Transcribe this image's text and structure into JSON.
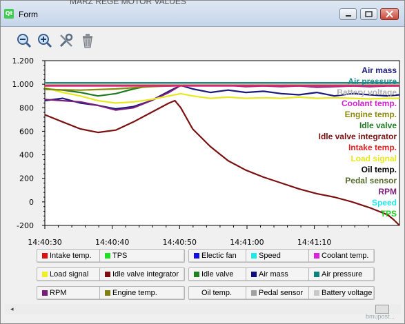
{
  "window": {
    "title": "Form",
    "logo": "Qt",
    "top_clip": "MARZ REGE MOTOR VALUES"
  },
  "controls": {
    "minimize": "minimize-icon",
    "maximize": "maximize-icon",
    "close": "close-icon"
  },
  "toolbar": {
    "tools": [
      "zoom-out-icon",
      "zoom-in-icon",
      "settings-tools-icon",
      "trash-icon"
    ]
  },
  "chart_data": {
    "type": "line",
    "y_ticks": [
      "1.200",
      "1.000",
      "800",
      "600",
      "400",
      "200",
      "0",
      "-200"
    ],
    "x_ticks": [
      "14:40:30",
      "14:40:40",
      "14:40:50",
      "14:41:00",
      "14:41:10"
    ],
    "ylim": [
      -200,
      1200
    ],
    "grid": false,
    "legend_placement": "right",
    "overlay_labels": [
      {
        "name": "Air mass",
        "color": "#1a1a7a"
      },
      {
        "name": "Air pressure",
        "color": "#1a8a8a"
      },
      {
        "name": "Battery voltage",
        "color": "#b0b0b0"
      },
      {
        "name": "Coolant temp.",
        "color": "#d020d0"
      },
      {
        "name": "Engine temp.",
        "color": "#8a8a10"
      },
      {
        "name": "Idle valve",
        "color": "#207a20"
      },
      {
        "name": "Idle valve integrator",
        "color": "#7a1010"
      },
      {
        "name": "Intake temp.",
        "color": "#e02020"
      },
      {
        "name": "Load signal",
        "color": "#e8e820"
      },
      {
        "name": "Oil temp.",
        "color": "#000000"
      },
      {
        "name": "Pedal sensor",
        "color": "#556b2f"
      },
      {
        "name": "RPM",
        "color": "#7a207a"
      },
      {
        "name": "Speed",
        "color": "#20e8e8"
      },
      {
        "name": "TPS",
        "color": "#20d020"
      }
    ],
    "series": [
      {
        "key": "idle_valve_integrator",
        "color": "#7a1010",
        "points": [
          [
            0,
            740
          ],
          [
            3,
            680
          ],
          [
            6,
            620
          ],
          [
            9,
            590
          ],
          [
            12,
            610
          ],
          [
            15,
            680
          ],
          [
            18,
            760
          ],
          [
            21,
            840
          ],
          [
            22,
            860
          ],
          [
            23,
            800
          ],
          [
            25,
            620
          ],
          [
            28,
            470
          ],
          [
            31,
            350
          ],
          [
            34,
            270
          ],
          [
            37,
            210
          ],
          [
            40,
            160
          ],
          [
            43,
            110
          ],
          [
            46,
            70
          ],
          [
            49,
            40
          ],
          [
            52,
            0
          ],
          [
            55,
            -50
          ],
          [
            58,
            -110
          ],
          [
            59,
            -150
          ],
          [
            60,
            -200
          ]
        ]
      },
      {
        "key": "air_mass",
        "color": "#1a1a7a",
        "points": [
          [
            0,
            860
          ],
          [
            3,
            880
          ],
          [
            6,
            840
          ],
          [
            9,
            820
          ],
          [
            12,
            790
          ],
          [
            15,
            810
          ],
          [
            18,
            860
          ],
          [
            21,
            940
          ],
          [
            23,
            990
          ],
          [
            25,
            960
          ],
          [
            28,
            930
          ],
          [
            31,
            950
          ],
          [
            34,
            930
          ],
          [
            37,
            940
          ],
          [
            40,
            920
          ],
          [
            43,
            910
          ],
          [
            46,
            930
          ],
          [
            49,
            900
          ],
          [
            52,
            920
          ],
          [
            55,
            910
          ],
          [
            58,
            900
          ],
          [
            60,
            910
          ]
        ]
      },
      {
        "key": "rpm",
        "color": "#7a207a",
        "points": [
          [
            0,
            870
          ],
          [
            3,
            860
          ],
          [
            6,
            850
          ],
          [
            9,
            820
          ],
          [
            12,
            780
          ],
          [
            15,
            800
          ],
          [
            18,
            860
          ],
          [
            21,
            930
          ],
          [
            23,
            990
          ],
          [
            25,
            1000
          ],
          [
            28,
            1000
          ],
          [
            31,
            990
          ],
          [
            34,
            980
          ],
          [
            37,
            985
          ],
          [
            40,
            980
          ],
          [
            43,
            985
          ],
          [
            46,
            975
          ],
          [
            49,
            980
          ],
          [
            52,
            985
          ],
          [
            55,
            980
          ],
          [
            58,
            985
          ],
          [
            60,
            985
          ]
        ]
      },
      {
        "key": "load_signal",
        "color": "#e8e820",
        "points": [
          [
            0,
            970
          ],
          [
            3,
            930
          ],
          [
            6,
            900
          ],
          [
            9,
            860
          ],
          [
            12,
            840
          ],
          [
            15,
            850
          ],
          [
            18,
            870
          ],
          [
            21,
            900
          ],
          [
            23,
            920
          ],
          [
            25,
            900
          ],
          [
            28,
            880
          ],
          [
            31,
            890
          ],
          [
            34,
            880
          ],
          [
            37,
            885
          ],
          [
            40,
            880
          ],
          [
            43,
            890
          ],
          [
            46,
            880
          ],
          [
            49,
            885
          ],
          [
            52,
            880
          ],
          [
            55,
            875
          ],
          [
            58,
            880
          ],
          [
            60,
            880
          ]
        ]
      },
      {
        "key": "idle_valve",
        "color": "#207a20",
        "points": [
          [
            0,
            960
          ],
          [
            3,
            950
          ],
          [
            6,
            930
          ],
          [
            9,
            900
          ],
          [
            12,
            920
          ],
          [
            15,
            960
          ],
          [
            18,
            990
          ],
          [
            21,
            1000
          ],
          [
            23,
            1005
          ],
          [
            60,
            1005
          ]
        ]
      },
      {
        "key": "engine_temp",
        "color": "#8a8a10",
        "points": [
          [
            0,
            955
          ],
          [
            6,
            950
          ],
          [
            12,
            960
          ],
          [
            18,
            980
          ],
          [
            24,
            990
          ],
          [
            30,
            990
          ],
          [
            40,
            992
          ],
          [
            60,
            992
          ]
        ]
      },
      {
        "key": "air_pressure",
        "color": "#1a8a8a",
        "points": [
          [
            0,
            1012
          ],
          [
            60,
            1012
          ]
        ]
      },
      {
        "key": "coolant_temp",
        "color": "#d020d0",
        "points": [
          [
            0,
            985
          ],
          [
            60,
            985
          ]
        ]
      },
      {
        "key": "intake_temp",
        "color": "#e02020",
        "points": [
          [
            0,
            990
          ],
          [
            60,
            990
          ]
        ]
      },
      {
        "key": "battery_voltage",
        "color": "#b0b0b0",
        "points": [
          [
            0,
            1000
          ],
          [
            60,
            1000
          ]
        ]
      }
    ]
  },
  "legend": [
    {
      "label": "Intake temp.",
      "color": "#e01010"
    },
    {
      "label": "TPS",
      "color": "#20e020"
    },
    {
      "label": "Electic fan",
      "color": "#1010e0"
    },
    {
      "label": "Speed",
      "color": "#20e8e8"
    },
    {
      "label": "Coolant temp.",
      "color": "#e020e0"
    },
    {
      "label": "Load signal",
      "color": "#f0f020"
    },
    {
      "label": "Idle valve integrator",
      "color": "#7a1010"
    },
    {
      "label": "Idle valve",
      "color": "#208020"
    },
    {
      "label": "Air mass",
      "color": "#10107a"
    },
    {
      "label": "Air pressure",
      "color": "#108080"
    },
    {
      "label": "RPM",
      "color": "#7a1a7a"
    },
    {
      "label": "Engine temp.",
      "color": "#808010"
    },
    {
      "label": "Oil temp.",
      "color": ""
    },
    {
      "label": "Pedal sensor",
      "color": "#a0a0a0"
    },
    {
      "label": "Battery voltage",
      "color": "#c8c8c8"
    }
  ],
  "scroll": {
    "left_arrow": "◂"
  },
  "watermark": "bmupost..."
}
